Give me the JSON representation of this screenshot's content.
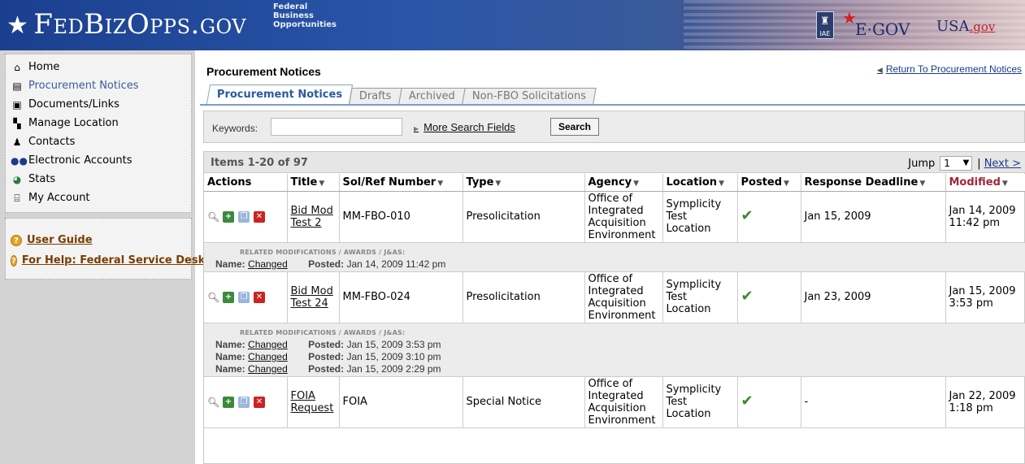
{
  "header": {
    "logo_text": "FedBizOpps.gov",
    "logo_sub": [
      "Federal",
      "Business",
      "Opportunities"
    ],
    "iae_label": "IAE",
    "egov_label": "E·GOV",
    "usagov_label": "USA",
    "usagov_suffix": ".gov",
    "colors": {
      "header_blue": "#1b3f8f",
      "header_red": "#7f2e3c"
    }
  },
  "sidebar": {
    "items": [
      {
        "label": "Home",
        "icon": "home-icon"
      },
      {
        "label": "Procurement Notices",
        "icon": "notices-icon"
      },
      {
        "label": "Documents/Links",
        "icon": "documents-icon"
      },
      {
        "label": "Manage Location",
        "icon": "location-icon"
      },
      {
        "label": "Contacts",
        "icon": "contacts-icon"
      },
      {
        "label": "Electronic Accounts",
        "icon": "accounts-icon"
      },
      {
        "label": "Stats",
        "icon": "stats-icon"
      },
      {
        "label": "My Account",
        "icon": "account-icon"
      }
    ],
    "help": [
      {
        "label": "User Guide",
        "icon": "help-icon"
      },
      {
        "label": "For Help: Federal Service Desk",
        "icon": "help-icon"
      }
    ]
  },
  "main": {
    "title": "Procurement Notices",
    "return_link": "Return To Procurement Notices",
    "tabs": [
      {
        "label": "Procurement Notices",
        "active": true
      },
      {
        "label": "Drafts",
        "active": false
      },
      {
        "label": "Archived",
        "active": false
      },
      {
        "label": "Non-FBO Solicitations",
        "active": false
      }
    ],
    "search": {
      "keywords_label": "Keywords:",
      "keywords_value": "",
      "more_fields": "More Search Fields",
      "search_button": "Search"
    },
    "results": {
      "count_label": "Items 1-20 of 97",
      "jump_label": "Jump",
      "jump_value": "1",
      "next_label": "Next >",
      "columns": [
        "Actions",
        "Title",
        "Sol/Ref Number",
        "Type",
        "Agency",
        "Location",
        "Posted",
        "Response Deadline",
        "Modified"
      ],
      "related_heading": "RELATED MODIFICATIONS / AWARDS / J&AS:",
      "name_label": "Name:",
      "posted_label": "Posted:",
      "rows": [
        {
          "title": "Bid Mod Test 2",
          "sol": "MM-FBO-010",
          "type": "Presolicitation",
          "agency": "Office of Integrated Acquisition Environment",
          "location": "Symplicity Test Location",
          "posted": "✔",
          "deadline": "Jan 15, 2009",
          "modified": "Jan 14, 2009 11:42 pm",
          "related": [
            {
              "name": "Changed",
              "posted": "Jan 14, 2009 11:42 pm"
            }
          ]
        },
        {
          "title": "Bid Mod Test 24",
          "sol": "MM-FBO-024",
          "type": "Presolicitation",
          "agency": "Office of Integrated Acquisition Environment",
          "location": "Symplicity Test Location",
          "posted": "✔",
          "deadline": "Jan 23, 2009",
          "modified": "Jan 15, 2009 3:53 pm",
          "related": [
            {
              "name": "Changed",
              "posted": "Jan 15, 2009 3:53 pm"
            },
            {
              "name": "Changed",
              "posted": "Jan 15, 2009 3:10 pm"
            },
            {
              "name": "Changed",
              "posted": "Jan 15, 2009 2:29 pm"
            }
          ]
        },
        {
          "title": "FOIA Request",
          "sol": "FOIA",
          "type": "Special Notice",
          "agency": "Office of Integrated Acquisition Environment",
          "location": "Symplicity Test Location",
          "posted": "✔",
          "deadline": "-",
          "modified": "Jan 22, 2009 1:18 pm",
          "related": []
        }
      ]
    }
  }
}
